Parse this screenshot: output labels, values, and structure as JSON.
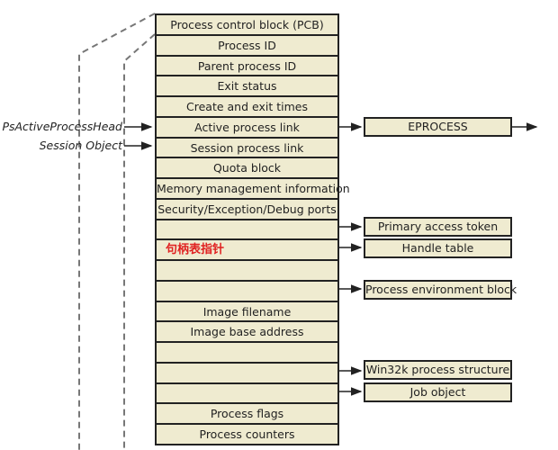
{
  "eprocess_fields": [
    "Process control block (PCB)",
    "Process ID",
    "Parent process ID",
    "Exit status",
    "Create and exit times",
    "Active process link",
    "Session process link",
    "Quota block",
    "Memory management information",
    "Security/Exception/Debug ports",
    "",
    "",
    "",
    "",
    "Image filename",
    "Image base address",
    "",
    "",
    "",
    "Process flags",
    "Process counters"
  ],
  "handle_table_annotation": "句柄表指针",
  "external_labels": {
    "active_head": "PsActiveProcessHead",
    "session": "Session Object"
  },
  "targets": {
    "eprocess": "EPROCESS",
    "primary_token": "Primary access token",
    "handle_table": "Handle table",
    "peb": "Process environment block",
    "win32k": "Win32k process structure",
    "job": "Job object"
  },
  "colors": {
    "field_fill": "#efebd0",
    "annotation": "#e02020",
    "border": "#222222"
  }
}
